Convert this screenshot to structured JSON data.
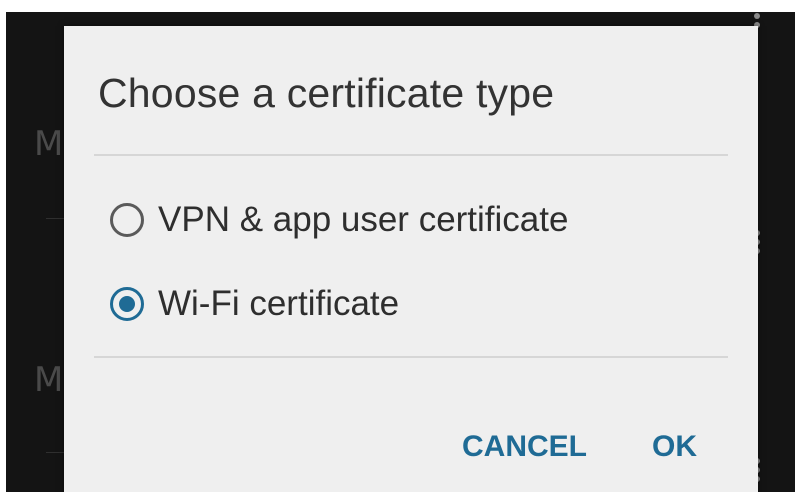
{
  "dialog": {
    "title": "Choose a certificate type",
    "options": [
      {
        "label": "VPN & app user certificate",
        "selected": false
      },
      {
        "label": "Wi-Fi certificate",
        "selected": true
      }
    ],
    "buttons": {
      "cancel": "CANCEL",
      "ok": "OK"
    }
  },
  "background": {
    "partial_letters": [
      "M",
      "M"
    ]
  },
  "colors": {
    "accent": "#1f6b95",
    "dialog_bg": "#efefef",
    "screen_bg": "#141414"
  }
}
